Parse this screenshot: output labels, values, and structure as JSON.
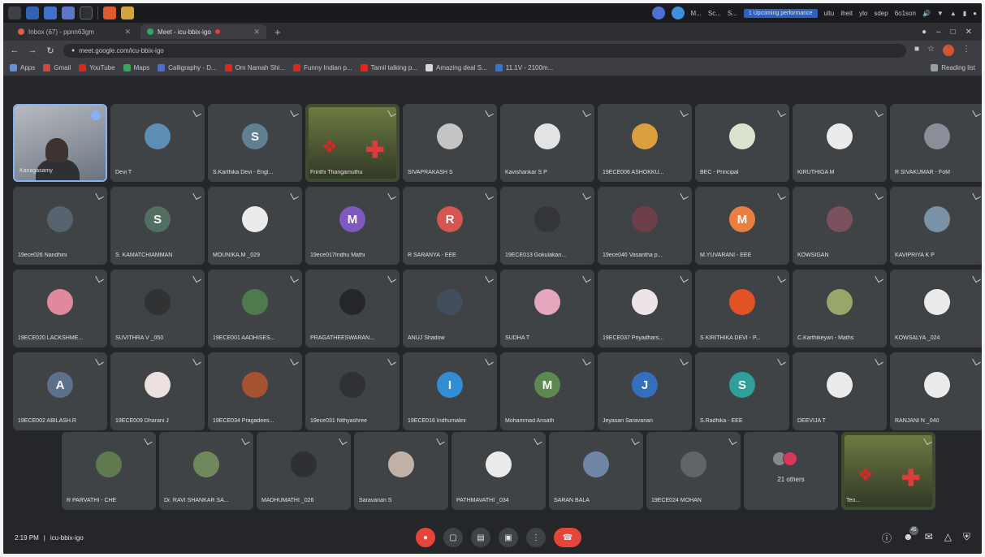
{
  "taskbar": {
    "window_titles": [
      "M...",
      "Sc...",
      "S..."
    ],
    "notice": "1 Upcoming performance",
    "tray_text": [
      "ultu",
      "iheit",
      "ylo",
      "sdep",
      "6o1son"
    ]
  },
  "browser": {
    "tabs": [
      {
        "label": "Inbox (67) - ppnn63gm",
        "active": false
      },
      {
        "label": "Meet - icu-bbix-igo",
        "active": true
      }
    ],
    "url": "meet.google.com/icu-bbix-igo",
    "bookmarks": [
      "Apps",
      "Gmail",
      "YouTube",
      "Maps",
      "Calligraphy - D...",
      "Om Namah Shi...",
      "Funny Indian p...",
      "Tamil talking p...",
      "Amazing deal S...",
      "11.1V - 2100m..."
    ],
    "reading_list": "Reading list"
  },
  "participants": [
    {
      "name": "Kanagasamy",
      "avatar_letter": "",
      "avatar_color": "#6c727c",
      "kind": "self"
    },
    {
      "name": "Devi T",
      "avatar_letter": "",
      "avatar_color": "#5c8fb8",
      "kind": "photo"
    },
    {
      "name": "S.Karthika Devi - Engl...",
      "avatar_letter": "S",
      "avatar_color": "#5f7f93",
      "kind": "letter"
    },
    {
      "name": "Frinthi Thangamuthu",
      "avatar_letter": "",
      "avatar_color": "#6b7a3e",
      "kind": "poster"
    },
    {
      "name": "SIVAPRAKASH S",
      "avatar_letter": "",
      "avatar_color": "#c9c9c9",
      "kind": "photo"
    },
    {
      "name": "Kavishankar S P",
      "avatar_letter": "",
      "avatar_color": "#e8e8e8",
      "kind": "photo"
    },
    {
      "name": "19ECE006 ASHOKKU...",
      "avatar_letter": "",
      "avatar_color": "#e0a23a",
      "kind": "photo"
    },
    {
      "name": "BEC - Principal",
      "avatar_letter": "",
      "avatar_color": "#dfe8cf",
      "kind": "photo"
    },
    {
      "name": "KIRUTHIGA M",
      "avatar_letter": "",
      "avatar_color": "#f1f1f1",
      "kind": "photo"
    },
    {
      "name": "R SIVAKUMAR - FoM",
      "avatar_letter": "",
      "avatar_color": "#8a8f99",
      "kind": "photo"
    },
    {
      "name": "19ece026 Nandhini",
      "avatar_letter": "",
      "avatar_color": "#55616e",
      "kind": "photo"
    },
    {
      "name": "S. KAMATCHIAMMAN",
      "avatar_letter": "S",
      "avatar_color": "#4f6f60",
      "kind": "letter"
    },
    {
      "name": "MOUNIKA.M _029",
      "avatar_letter": "",
      "avatar_color": "#f1f1f1",
      "kind": "photo"
    },
    {
      "name": "19ece017Indhu Mathi",
      "avatar_letter": "M",
      "avatar_color": "#7e57c2",
      "kind": "letter"
    },
    {
      "name": "R SARANYA - EEE",
      "avatar_letter": "R",
      "avatar_color": "#d9534f",
      "kind": "letter"
    },
    {
      "name": "19ECE013 Gokulakan...",
      "avatar_letter": "",
      "avatar_color": "#2f3134",
      "kind": "photo"
    },
    {
      "name": "19ece046 Vasantha p...",
      "avatar_letter": "",
      "avatar_color": "#6d3c48",
      "kind": "photo"
    },
    {
      "name": "M.YUVARANI - EEE",
      "avatar_letter": "M",
      "avatar_color": "#f07f3c",
      "kind": "letter"
    },
    {
      "name": "KOWSIGAN",
      "avatar_letter": "",
      "avatar_color": "#7a4f5a",
      "kind": "photo"
    },
    {
      "name": "KAVIPRIYA K P",
      "avatar_letter": "",
      "avatar_color": "#7a93a8",
      "kind": "photo"
    },
    {
      "name": "19ECE020 LACKSHME...",
      "avatar_letter": "",
      "avatar_color": "#e58aa0",
      "kind": "photo"
    },
    {
      "name": "SUVITHRA V _050",
      "avatar_letter": "",
      "avatar_color": "#2c2e30",
      "kind": "photo"
    },
    {
      "name": "19ECE001 AADHISES...",
      "avatar_letter": "",
      "avatar_color": "#4c7a4a",
      "kind": "photo"
    },
    {
      "name": "PRAGATHEESWARAN...",
      "avatar_letter": "",
      "avatar_color": "#202124",
      "kind": "photo"
    },
    {
      "name": "ANUJ Shadow",
      "avatar_letter": "",
      "avatar_color": "#3e4a5a",
      "kind": "photo"
    },
    {
      "name": "SUDHA T",
      "avatar_letter": "",
      "avatar_color": "#e9a9c0",
      "kind": "photo"
    },
    {
      "name": "19ECE037 Priyadhars...",
      "avatar_letter": "",
      "avatar_color": "#f3e9ec",
      "kind": "photo"
    },
    {
      "name": "S KIRITHIKA DEVI - P...",
      "avatar_letter": "",
      "avatar_color": "#e8501f",
      "kind": "photo"
    },
    {
      "name": "C.Karthikeyan - Maths",
      "avatar_letter": "",
      "avatar_color": "#98a96a",
      "kind": "photo"
    },
    {
      "name": "KOWSALYA _024",
      "avatar_letter": "",
      "avatar_color": "#f1f1f1",
      "kind": "photo"
    },
    {
      "name": "19ECE002 ABILASH.R",
      "avatar_letter": "A",
      "avatar_color": "#5b6f8a",
      "kind": "letter"
    },
    {
      "name": "19ECE009 Dharani J",
      "avatar_letter": "",
      "avatar_color": "#f2e4e4",
      "kind": "photo"
    },
    {
      "name": "19ECE034 Pragadees...",
      "avatar_letter": "",
      "avatar_color": "#a8502d",
      "kind": "photo"
    },
    {
      "name": "19ece031 Nithyashree",
      "avatar_letter": "",
      "avatar_color": "#2b2d30",
      "kind": "photo"
    },
    {
      "name": "19ECE016 Indhumalini",
      "avatar_letter": "I",
      "avatar_color": "#2e8fd6",
      "kind": "letter"
    },
    {
      "name": "Mohammad Ansath",
      "avatar_letter": "M",
      "avatar_color": "#5b8a4f",
      "kind": "letter"
    },
    {
      "name": "Jeyasari Saravanan",
      "avatar_letter": "J",
      "avatar_color": "#2f6fbf",
      "kind": "letter"
    },
    {
      "name": "S.Radhika - EEE",
      "avatar_letter": "S",
      "avatar_color": "#2aa19a",
      "kind": "letter"
    },
    {
      "name": "DEEVIJA T",
      "avatar_letter": "",
      "avatar_color": "#f1f1f1",
      "kind": "photo"
    },
    {
      "name": "RANJANI N _040",
      "avatar_letter": "",
      "avatar_color": "#f1f1f1",
      "kind": "photo"
    }
  ],
  "last_row": [
    {
      "name": "R PARVATHI - CHE",
      "avatar_letter": "",
      "avatar_color": "#5e7a4c",
      "kind": "photo"
    },
    {
      "name": "Dr. RAVI SHANKAR SA...",
      "avatar_letter": "",
      "avatar_color": "#6f8a5a",
      "kind": "photo"
    },
    {
      "name": "MADHUMATHI _026",
      "avatar_letter": "",
      "avatar_color": "#2b2c2f",
      "kind": "photo"
    },
    {
      "name": "Saravanan S",
      "avatar_letter": "",
      "avatar_color": "#c4b4a8",
      "kind": "photo"
    },
    {
      "name": "PATHMAVATHI _034",
      "avatar_letter": "",
      "avatar_color": "#f1f1f1",
      "kind": "photo"
    },
    {
      "name": "SARAN BALA",
      "avatar_letter": "",
      "avatar_color": "#6f86a8",
      "kind": "photo"
    },
    {
      "name": "19ECE024 MOHAN",
      "avatar_letter": "",
      "avatar_color": "#5f6368",
      "kind": "photo"
    },
    {
      "name": "21 others",
      "avatar_letter": "",
      "avatar_color": "#888888",
      "kind": "others"
    },
    {
      "name": "Teo...",
      "avatar_letter": "",
      "avatar_color": "#6b7a3e",
      "kind": "poster"
    }
  ],
  "controls": {
    "time": "2:19 PM",
    "separator": "|",
    "meeting_code": "icu-bbix-igo",
    "people_count": "45"
  }
}
